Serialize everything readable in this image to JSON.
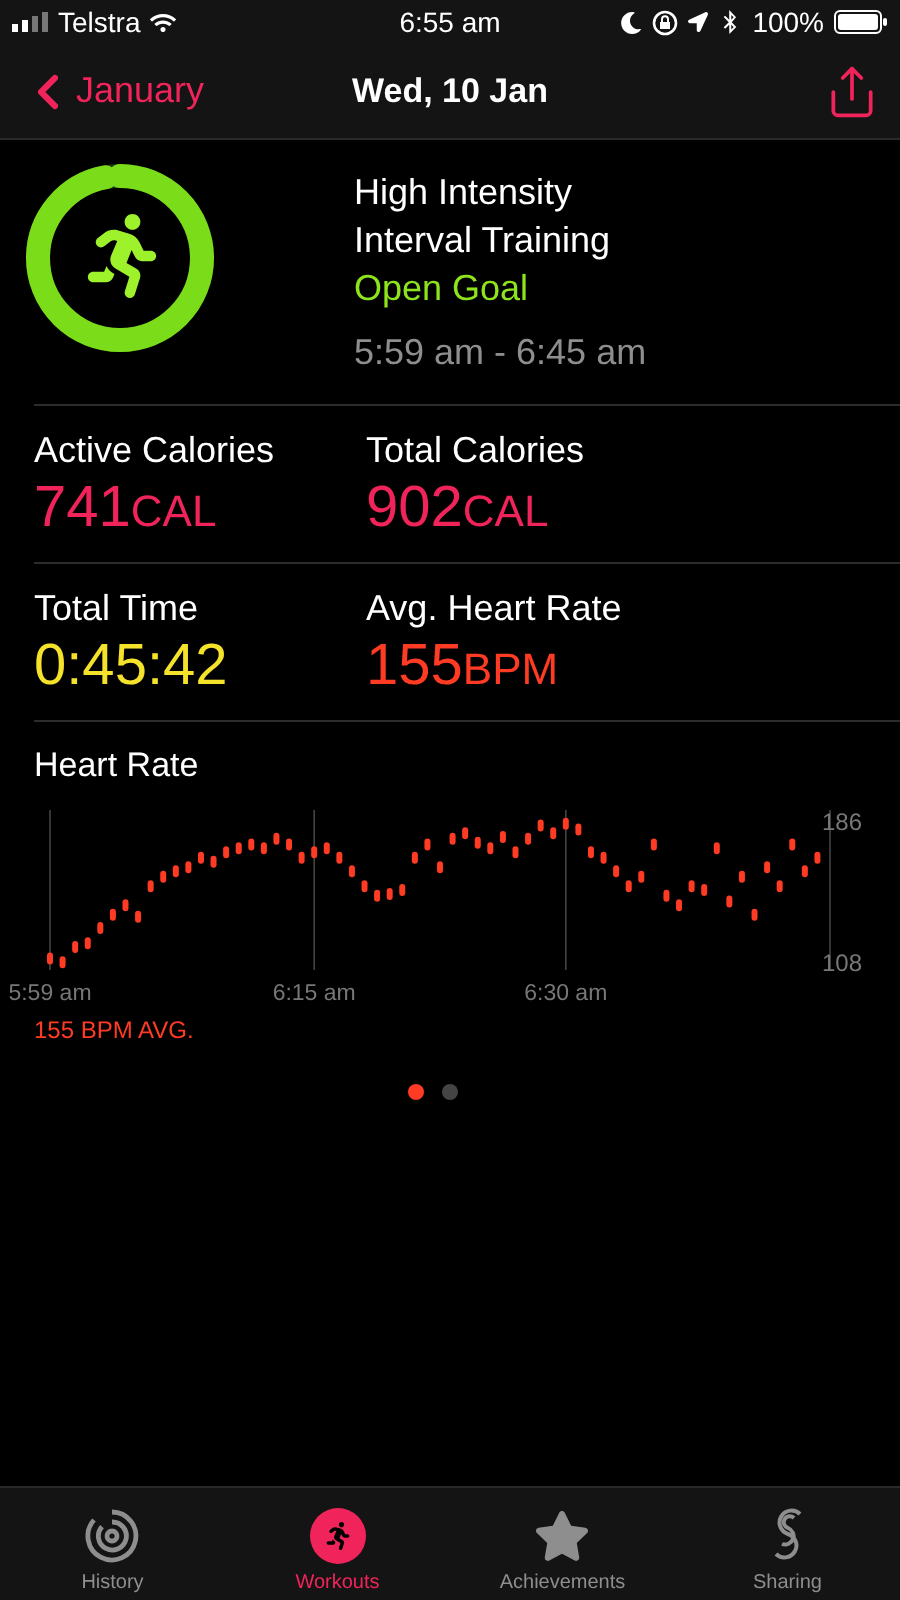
{
  "status_bar": {
    "carrier": "Telstra",
    "time": "6:55 am",
    "battery": "100%"
  },
  "nav": {
    "back": "January",
    "title": "Wed, 10 Jan"
  },
  "workout": {
    "name_lines": [
      "High Intensity",
      "Interval Training"
    ],
    "goal": "Open Goal",
    "time_range": "5:59 am - 6:45 am"
  },
  "metrics": [
    {
      "label": "Active Calories",
      "value": "741",
      "unit": "CAL",
      "color": "#f0245a"
    },
    {
      "label": "Total Calories",
      "value": "902",
      "unit": "CAL",
      "color": "#f0245a"
    },
    {
      "label": "Total Time",
      "value": "0:45:42",
      "color": "#f5e22a"
    },
    {
      "label": "Avg. Heart Rate",
      "value": "155",
      "unit": "BPM",
      "color": "#ff3b24"
    }
  ],
  "heart_rate": {
    "average": "155 BPM AVG.",
    "chart_data": {
      "type": "scatter",
      "title": "Heart Rate",
      "ylim": [
        108,
        186
      ],
      "grid": true,
      "yticks": [
        {
          "value": 108,
          "label": "108"
        },
        {
          "value": 186,
          "label": "186"
        }
      ],
      "categories": [
        "5:59 am",
        null,
        null,
        null,
        null,
        null,
        null,
        null,
        null,
        null,
        null,
        null,
        null,
        null,
        null,
        null,
        null,
        null,
        null,
        null,
        null,
        "6:15 am",
        null,
        null,
        null,
        null,
        null,
        null,
        null,
        null,
        null,
        null,
        null,
        null,
        null,
        null,
        null,
        null,
        null,
        null,
        null,
        "6:30 am",
        null,
        null,
        null,
        null,
        null,
        null,
        null,
        null,
        null,
        null,
        null,
        null,
        null,
        null,
        null,
        null,
        null,
        null,
        null,
        null
      ],
      "series": [
        {
          "color": "#ff3b24",
          "values": [
            112,
            110,
            118,
            120,
            128,
            135,
            140,
            134,
            150,
            155,
            158,
            160,
            165,
            163,
            168,
            170,
            172,
            170,
            175,
            172,
            165,
            168,
            170,
            165,
            158,
            150,
            145,
            146,
            148,
            165,
            172,
            160,
            175,
            178,
            173,
            170,
            176,
            168,
            175,
            182,
            178,
            183,
            180,
            168,
            165,
            158,
            150,
            155,
            172,
            145,
            140,
            150,
            148,
            170,
            142,
            155,
            135,
            160,
            150,
            172,
            158,
            165
          ]
        }
      ]
    }
  },
  "pager": [
    {
      "selected": true
    },
    {
      "selected": false
    }
  ],
  "tabs": [
    {
      "label": "History",
      "kind": "history",
      "selected": false
    },
    {
      "label": "Workouts",
      "kind": "workouts",
      "selected": true
    },
    {
      "label": "Achievements",
      "kind": "achievements",
      "selected": false
    },
    {
      "label": "Sharing",
      "kind": "sharing",
      "selected": false
    }
  ]
}
